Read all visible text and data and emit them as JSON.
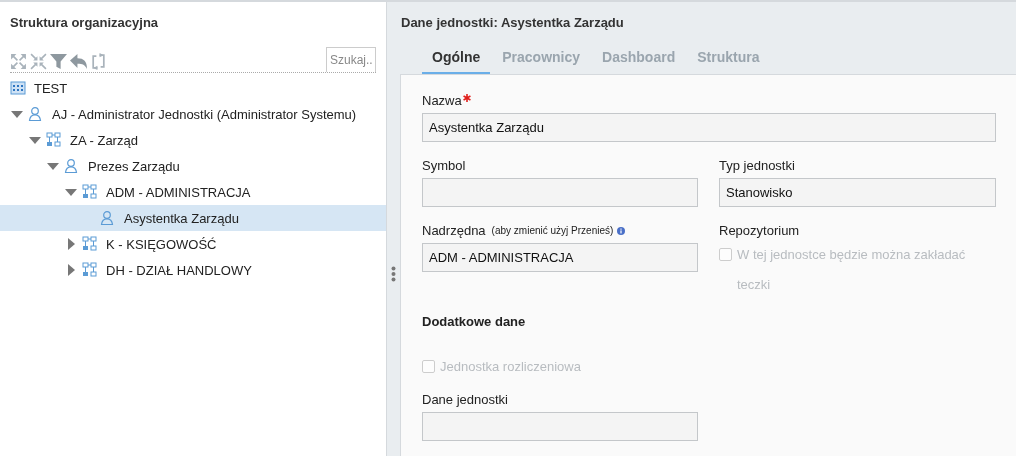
{
  "left_panel": {
    "title": "Struktura organizacyjna",
    "search": {
      "placeholder": "Szukaj.."
    },
    "tree": [
      {
        "kind": "building",
        "label": "TEST"
      },
      {
        "kind": "person",
        "label": "AJ - Administrator Jednostki (Administrator Systemu)",
        "expanded": true,
        "selected": false,
        "children": [
          {
            "kind": "org",
            "label": "ZA - Zarząd",
            "expanded": true,
            "selected": false,
            "children": [
              {
                "kind": "person",
                "label": "Prezes Zarządu",
                "expanded": true,
                "selected": false,
                "children": [
                  {
                    "kind": "org",
                    "label": "ADM - ADMINISTRACJA",
                    "expanded": true,
                    "selected": false,
                    "children": [
                      {
                        "kind": "person",
                        "label": "Asystentka Zarządu",
                        "selected": true
                      }
                    ]
                  },
                  {
                    "kind": "org",
                    "label": "K - KSIĘGOWOŚĆ",
                    "expanded": false,
                    "selected": false
                  },
                  {
                    "kind": "org",
                    "label": "DH - DZIAŁ HANDLOWY",
                    "expanded": false,
                    "selected": false
                  }
                ]
              }
            ]
          }
        ]
      }
    ]
  },
  "right_panel": {
    "title": "Dane jednostki: Asystentka Zarządu",
    "tabs": [
      {
        "label": "Ogólne",
        "selected": true
      },
      {
        "label": "Pracownicy",
        "selected": false
      },
      {
        "label": "Dashboard",
        "selected": false
      },
      {
        "label": "Struktura",
        "selected": false
      }
    ],
    "form": {
      "name_field": {
        "label": "Nazwa",
        "required": true,
        "value": "Asystentka Zarządu"
      },
      "symbol_field": {
        "label": "Symbol"
      },
      "type_field": {
        "label": "Typ jednostki",
        "value": "Stanowisko"
      },
      "parent_field": {
        "label": "Nadrzędna",
        "hint": "(aby zmienić użyj Przenieś)",
        "value": "ADM - ADMINISTRACJA"
      },
      "repository": {
        "label": "Repozytorium",
        "checkbox": {
          "label": "W tej jednostce będzie można zakładać teczki",
          "checked": false,
          "disabled": true
        }
      },
      "section_title": "Dodatkowe dane",
      "settlement_checkbox": {
        "label": "Jednostka rozliczeniowa",
        "checked": false,
        "disabled": true
      },
      "data_field": {
        "label": "Dane jednostki"
      }
    }
  }
}
